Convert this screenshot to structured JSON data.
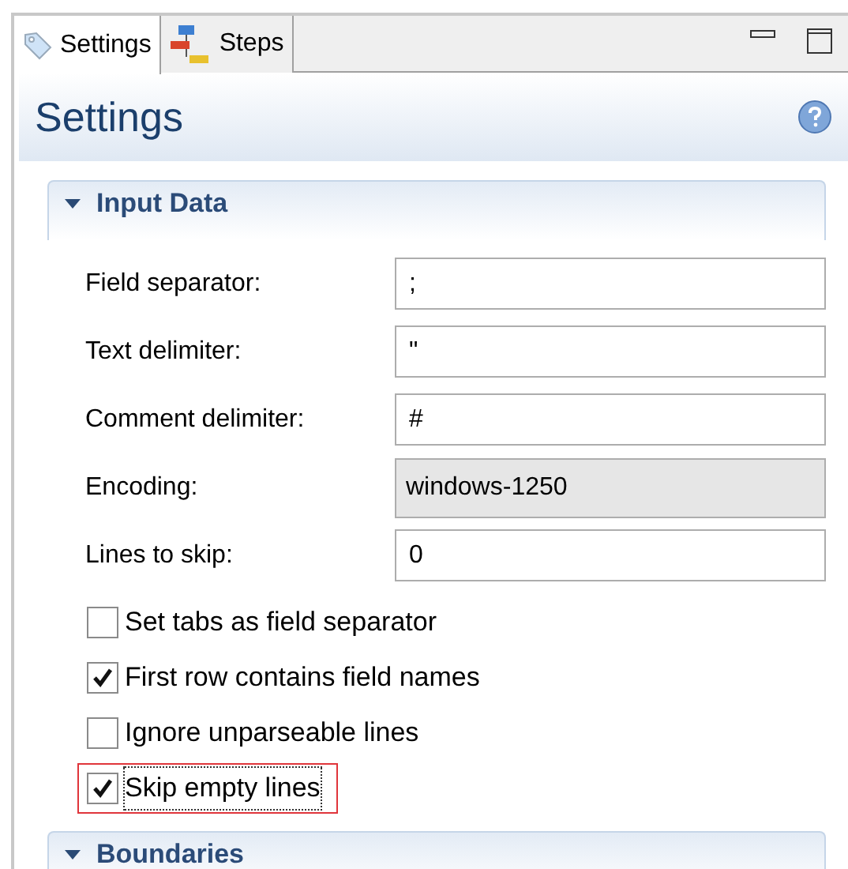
{
  "tabs": [
    {
      "label": "Settings",
      "selected": true,
      "kind": "tag"
    },
    {
      "label": "Steps",
      "selected": false,
      "kind": "steps"
    }
  ],
  "header": {
    "title": "Settings"
  },
  "sections": [
    {
      "title": "Input Data",
      "expanded": true,
      "fields": [
        {
          "label": "Field separator:",
          "value": ";",
          "kind": "text"
        },
        {
          "label": "Text delimiter:",
          "value": "\"",
          "kind": "text"
        },
        {
          "label": "Comment delimiter:",
          "value": "#",
          "kind": "text"
        },
        {
          "label": "Encoding:",
          "value": "windows-1250",
          "kind": "combo"
        },
        {
          "label": "Lines to skip:",
          "value": "0",
          "kind": "text"
        }
      ],
      "checkboxes": [
        {
          "label": "Set tabs as field separator",
          "checked": false,
          "highlighted": false
        },
        {
          "label": "First row contains field names",
          "checked": true,
          "highlighted": false
        },
        {
          "label": "Ignore unparseable lines",
          "checked": false,
          "highlighted": false
        },
        {
          "label": "Skip empty lines",
          "checked": true,
          "highlighted": true
        }
      ]
    },
    {
      "title": "Boundaries",
      "expanded": true
    }
  ]
}
